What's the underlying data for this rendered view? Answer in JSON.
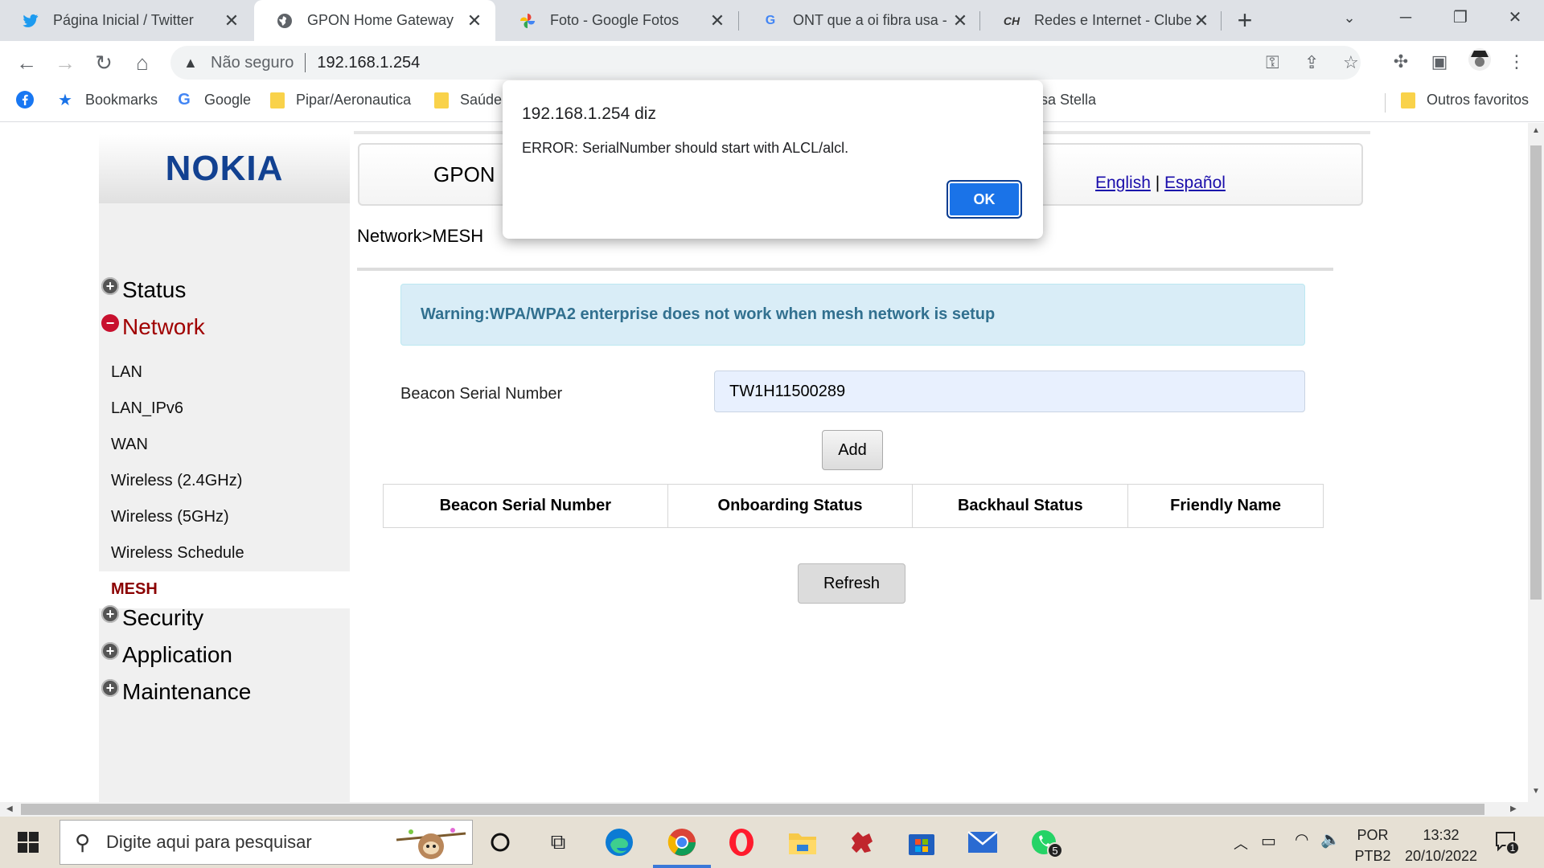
{
  "browser": {
    "tabs": [
      {
        "label": "Página Inicial / Twitter",
        "icon": "twitter-icon",
        "active": false
      },
      {
        "label": "GPON Home Gateway",
        "icon": "globe-icon",
        "active": true
      },
      {
        "label": "Foto - Google Fotos",
        "icon": "google-photos-icon",
        "active": false
      },
      {
        "label": "ONT que a oi fibra usa - P",
        "icon": "google-icon",
        "active": false
      },
      {
        "label": "Redes e Internet - Clube d",
        "icon": "clube-hardware-icon",
        "active": false
      }
    ],
    "address": {
      "security_label": "Não seguro",
      "url": "192.168.1.254"
    },
    "bookmarks": [
      {
        "label": "",
        "icon": "facebook-icon"
      },
      {
        "label": "Bookmarks",
        "icon": "star-icon"
      },
      {
        "label": "Google",
        "icon": "google-icon"
      },
      {
        "label": "Pipar/Aeronautica",
        "icon": "folder-icon"
      },
      {
        "label": "Saúde",
        "icon": "folder-icon"
      },
      {
        "label": "sa Stella",
        "icon": ""
      },
      {
        "label": "Outros favoritos",
        "icon": "folder-icon"
      }
    ]
  },
  "router": {
    "brand": "NOKIA",
    "header_title": "GPON",
    "lang_english": "English",
    "lang_separator": "|",
    "lang_spanish": "Español",
    "breadcrumb": "Network>MESH",
    "sidebar": {
      "status": "Status",
      "network": "Network",
      "network_items": [
        "LAN",
        "LAN_IPv6",
        "WAN",
        "Wireless (2.4GHz)",
        "Wireless (5GHz)",
        "Wireless Schedule",
        "MESH"
      ],
      "security": "Security",
      "application": "Application",
      "maintenance": "Maintenance"
    },
    "warning": "Warning:WPA/WPA2 enterprise does not work when mesh network is setup",
    "beacon_label": "Beacon Serial Number",
    "beacon_value": "TW1H11500289",
    "add_label": "Add",
    "table_headers": [
      "Beacon Serial Number",
      "Onboarding Status",
      "Backhaul Status",
      "Friendly Name"
    ],
    "refresh_label": "Refresh"
  },
  "dialog": {
    "title": "192.168.1.254 diz",
    "message": "ERROR: SerialNumber should start with ALCL/alcl.",
    "ok_label": "OK"
  },
  "taskbar": {
    "search_placeholder": "Digite aqui para pesquisar",
    "lang_top": "POR",
    "lang_bottom": "PTB2",
    "time": "13:32",
    "date": "20/10/2022",
    "whatsapp_badge": "5",
    "notification_badge": "1"
  },
  "colors": {
    "nokia_blue": "#124191",
    "network_active": "#a00000",
    "warning_bg": "#d9edf7",
    "warning_text": "#31708f",
    "dialog_ok": "#1a73e8"
  }
}
